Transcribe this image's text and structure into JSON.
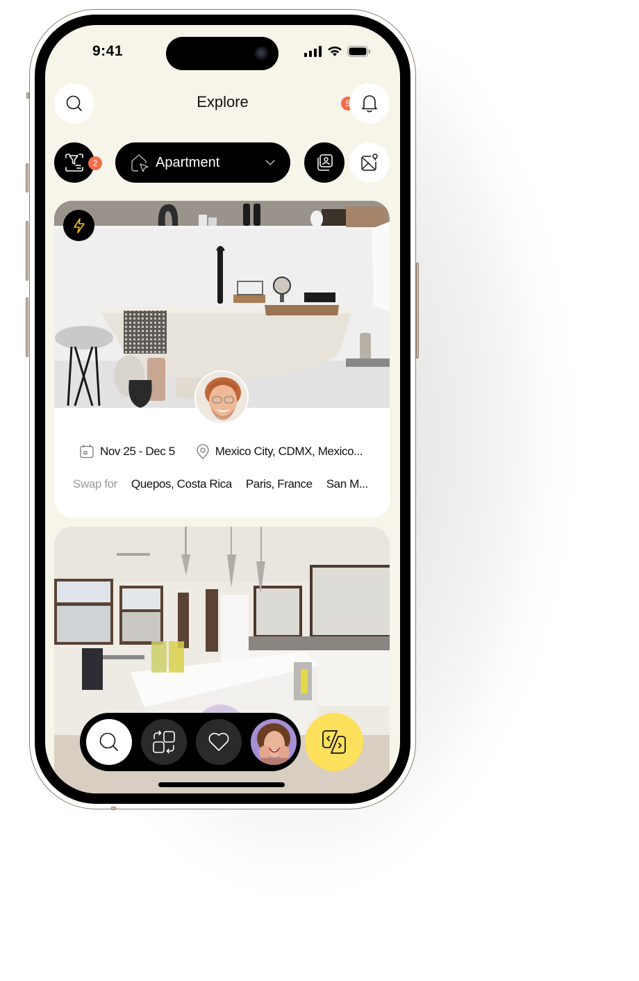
{
  "status_bar": {
    "time": "9:41",
    "icons": [
      "cellular-signal-icon",
      "wifi-icon",
      "battery-icon"
    ]
  },
  "header": {
    "title": "Explore",
    "search_icon": "search-icon",
    "notifications": {
      "icon": "bell-icon",
      "badge_count": "5"
    }
  },
  "filters": {
    "filter_button": {
      "icon": "filter-icon",
      "badge_count": "2"
    },
    "property_type": {
      "icon": "home-cursor-icon",
      "selected": "Apartment",
      "chevron": "chevron-down-icon"
    },
    "gallery_button": {
      "icon": "gallery-icon"
    },
    "map_button": {
      "icon": "map-pin-icon"
    }
  },
  "listings": [
    {
      "photo": "bathroom-photo",
      "instant_icon": "lightning-icon",
      "host_avatar": "host-avatar-man",
      "dates": "Nov 25 - Dec 5",
      "location": "Mexico City, CDMX, Mexico...",
      "swap_label": "Swap for",
      "swap_destinations": [
        "Quepos, Costa Rica",
        "Paris, France",
        "San M..."
      ]
    },
    {
      "photo": "kitchen-photo",
      "host_avatar": "host-avatar-woman"
    }
  ],
  "bottom_nav": {
    "items": [
      {
        "name": "search",
        "icon": "search-icon",
        "active": true
      },
      {
        "name": "swaps",
        "icon": "swap-arrows-icon",
        "active": false
      },
      {
        "name": "favorites",
        "icon": "heart-icon",
        "active": false
      },
      {
        "name": "profile",
        "icon": "profile-avatar",
        "active": false
      }
    ],
    "fab": {
      "icon": "swap-code-icon"
    }
  },
  "colors": {
    "screen_bg": "#f7f5ea",
    "badge": "#f26d4d",
    "fab_yellow": "#fde05c",
    "accent_bolt": "#f5c518"
  }
}
